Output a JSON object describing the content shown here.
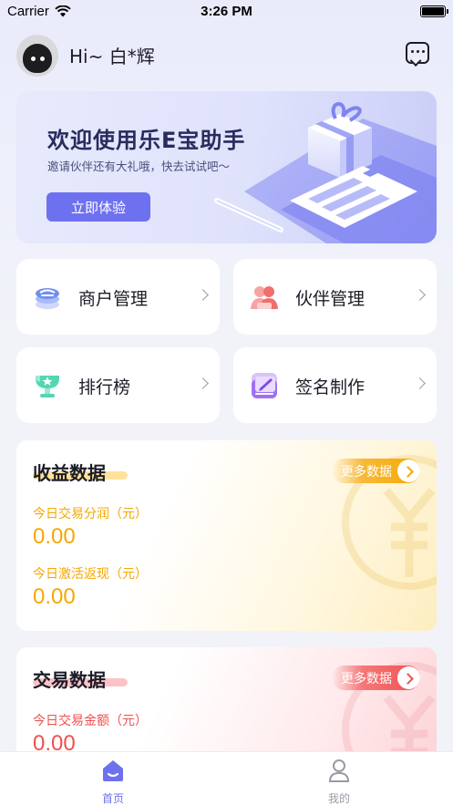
{
  "status_bar": {
    "carrier": "Carrier",
    "time": "3:26 PM"
  },
  "header": {
    "greeting": "Hi~ 白*辉"
  },
  "banner": {
    "title": "欢迎使用乐E宝助手",
    "subtitle": "邀请伙伴还有大礼哦，快去试试吧～",
    "button_label": "立即体验"
  },
  "tiles": [
    {
      "label": "商户管理",
      "icon": "merchant-stack-icon"
    },
    {
      "label": "伙伴管理",
      "icon": "partners-icon"
    },
    {
      "label": "排行榜",
      "icon": "trophy-icon"
    },
    {
      "label": "签名制作",
      "icon": "signature-icon"
    }
  ],
  "income": {
    "title": "收益数据",
    "more_label": "更多数据",
    "metrics": [
      {
        "label": "今日交易分润（元）",
        "value": "0.00"
      },
      {
        "label": "今日激活返现（元）",
        "value": "0.00"
      }
    ]
  },
  "trade": {
    "title": "交易数据",
    "more_label": "更多数据",
    "metrics": [
      {
        "label": "今日交易金额（元）",
        "value": "0.00"
      }
    ]
  },
  "tabbar": {
    "items": [
      {
        "label": "首页",
        "icon": "home-icon",
        "active": true
      },
      {
        "label": "我的",
        "icon": "profile-icon",
        "active": false
      }
    ]
  },
  "colors": {
    "accent": "#6e71ef",
    "income_orange": "#f5a800",
    "trade_red": "#f0504f",
    "tab_inactive": "#9a9aa6"
  }
}
